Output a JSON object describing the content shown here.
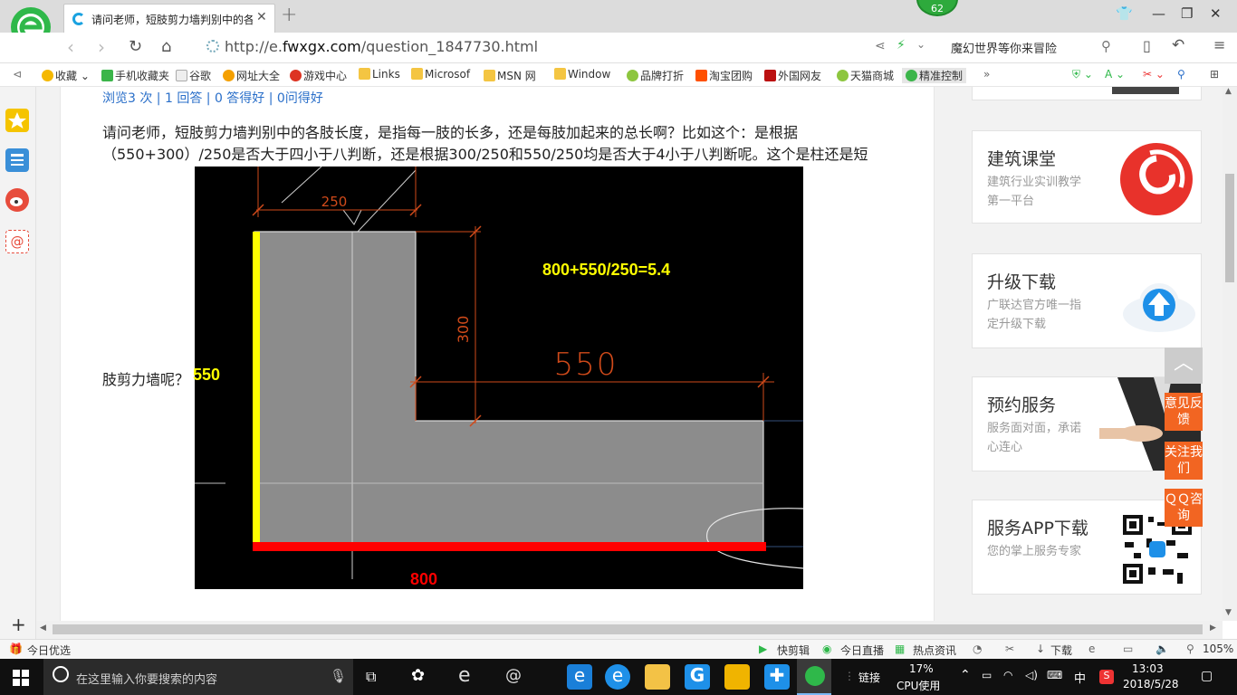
{
  "browser": {
    "tab_title": "请问老师，短肢剪力墙判别中的各",
    "badge": "62",
    "url_prefix": "http://e.",
    "url_domain": "fwxgx.com",
    "url_path": "/question_1847730.html",
    "search_text": "魔幻世界等你来冒险",
    "bookmarks": [
      "收藏",
      "手机收藏夹",
      "谷歌",
      "网址大全",
      "游戏中心",
      "Links",
      "Microsof",
      "MSN 网",
      "Window",
      "品牌打折",
      "淘宝团购",
      "外国网友",
      "天猫商城",
      "精准控制"
    ],
    "more": "»"
  },
  "page": {
    "stats": "浏览3 次 | 1 回答 | 0 答得好 | 0问得好",
    "question_line1": "请问老师，短肢剪力墙判别中的各肢长度，是指每一肢的长多，还是每肢加起来的总长啊？比如这个：是根据",
    "question_line2": "（550+300）/250是否大于四小于八判断，还是根据300/250和550/250均是否大于4小于八判断呢。这个是柱还是短",
    "question_line3": "肢剪力墙呢？",
    "drawing": {
      "formula": "800+550/250=5.4",
      "dim_250": "250",
      "dim_300": "300",
      "dim_550_cad": "550",
      "label_550": "550",
      "label_800": "800"
    }
  },
  "sidebar": {
    "cards": [
      {
        "title": "建筑课堂",
        "desc": "建筑行业实训教学第一平台",
        "icon": "spiral-logo-icon"
      },
      {
        "title": "升级下载",
        "desc": "广联达官方唯一指定升级下载",
        "icon": "cloud-upload-icon"
      },
      {
        "title": "预约服务",
        "desc": "服务面对面，承诺心连心",
        "icon": "handshake-icon"
      },
      {
        "title": "服务APP下载",
        "desc": "您的掌上服务专家",
        "icon": "qr-code-icon"
      }
    ],
    "float_buttons": [
      "意见反馈",
      "关注我们",
      "ＱＱ咨询"
    ]
  },
  "statusbar": {
    "left": "今日优选",
    "items": [
      "快剪辑",
      "今日直播",
      "热点资讯",
      "下载"
    ],
    "zoom": "105%"
  },
  "taskbar": {
    "search_placeholder": "在这里输入你要搜索的内容",
    "link_label": "链接",
    "cpu_value": "17%",
    "cpu_label": "CPU使用",
    "ime": "中",
    "time": "13:03",
    "date": "2018/5/28"
  }
}
